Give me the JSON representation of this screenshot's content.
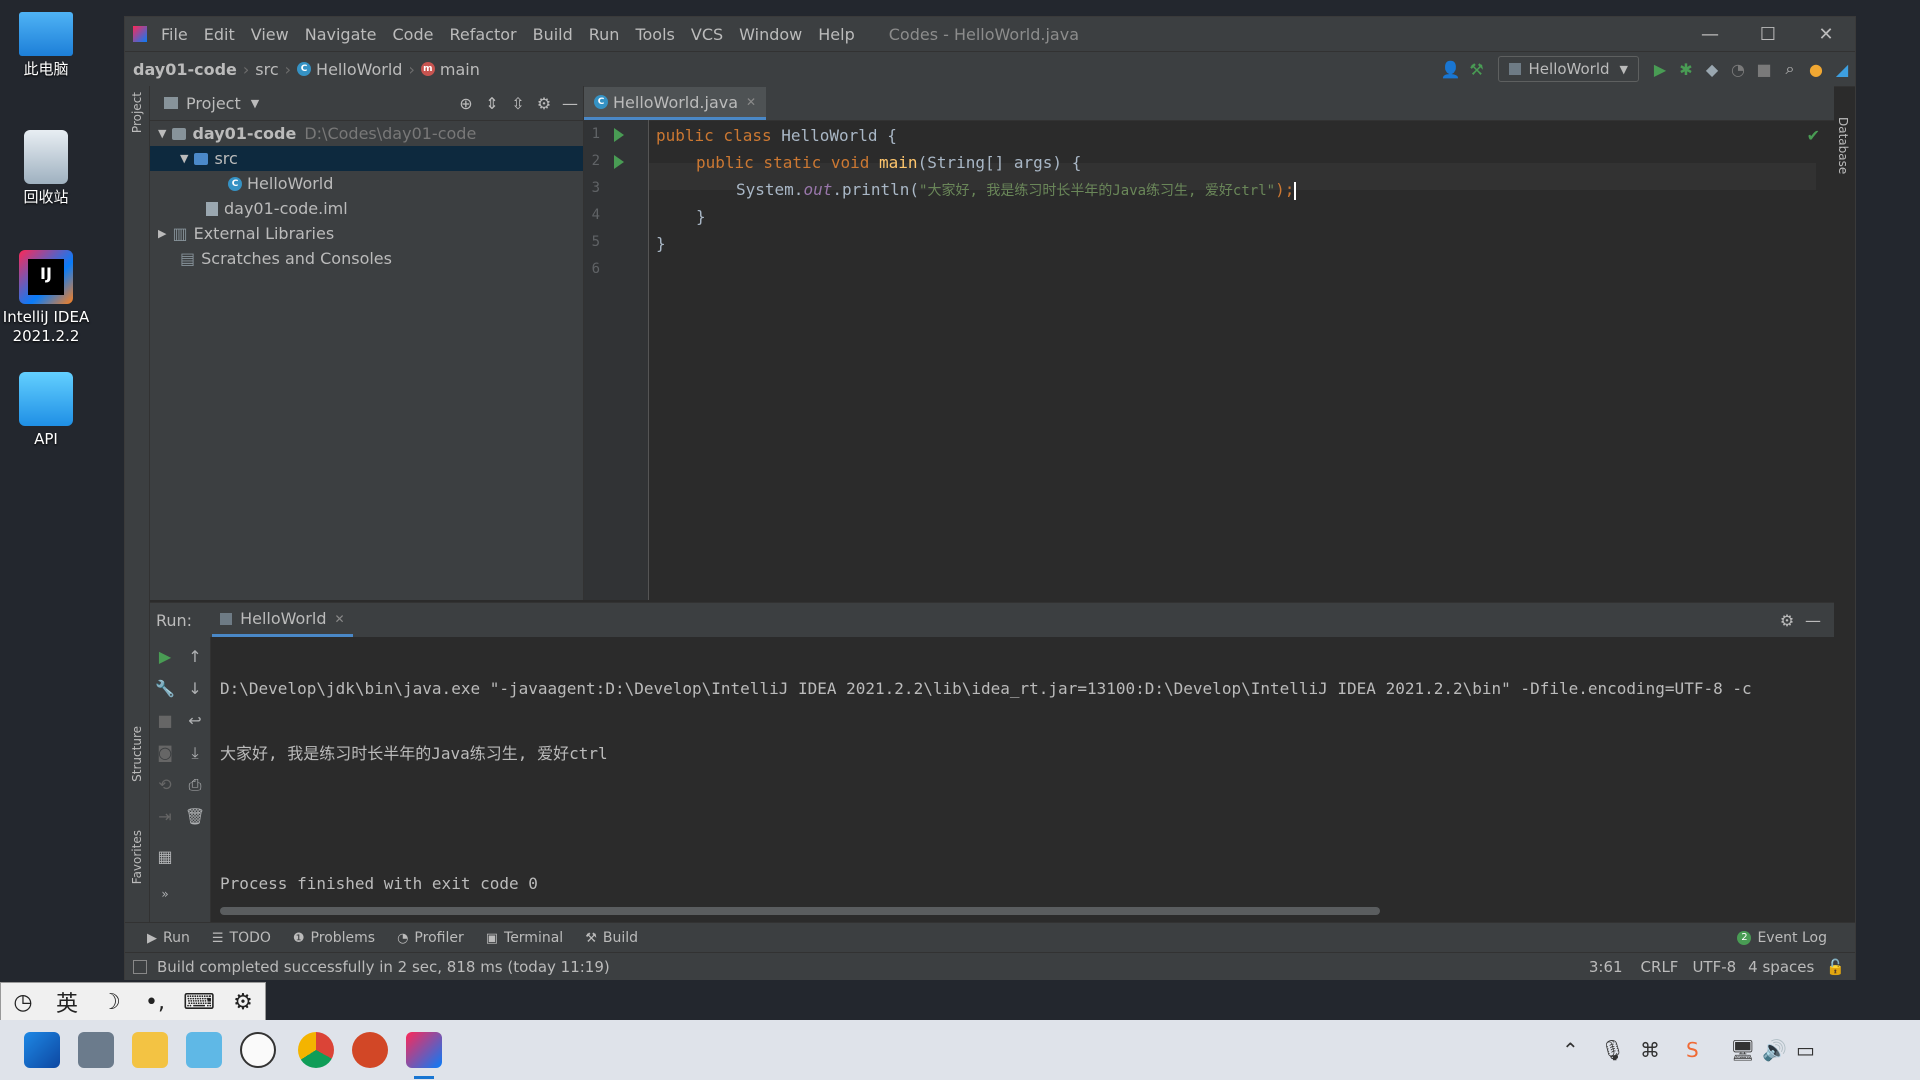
{
  "desktop": {
    "icons": [
      {
        "label": "此电脑"
      },
      {
        "label": "回收站"
      },
      {
        "label": "IntelliJ IDEA\n2021.2.2"
      },
      {
        "label": "API"
      }
    ]
  },
  "window": {
    "title": "Codes - HelloWorld.java",
    "menu": [
      "File",
      "Edit",
      "View",
      "Navigate",
      "Code",
      "Refactor",
      "Build",
      "Run",
      "Tools",
      "VCS",
      "Window",
      "Help"
    ],
    "controls": {
      "minimize": "—",
      "maximize": "☐",
      "close": "✕"
    }
  },
  "navbar": {
    "breadcrumb": [
      "day01-code",
      "src",
      "HelloWorld",
      "main"
    ],
    "run_config": "HelloWorld"
  },
  "tool_stripe": {
    "project": "Project",
    "structure": "Structure",
    "favorites": "Favorites",
    "database": "Database"
  },
  "project_panel": {
    "title": "Project",
    "tree": [
      {
        "label": "day01-code",
        "path": "D:\\Codes\\day01-code"
      },
      {
        "label": "src"
      },
      {
        "label": "HelloWorld"
      },
      {
        "label": "day01-code.iml"
      },
      {
        "label": "External Libraries"
      },
      {
        "label": "Scratches and Consoles"
      }
    ]
  },
  "editor": {
    "tab": "HelloWorld.java",
    "line_numbers": [
      "1",
      "2",
      "3",
      "4",
      "5",
      "6"
    ],
    "lines": {
      "l1_kw": "public class ",
      "l1_name": "HelloWorld {",
      "l2_kw": "public static void ",
      "l2_fn": "main",
      "l2_rest": "(String[] args) {",
      "l3_a": "System.",
      "l3_out": "out",
      "l3_b": ".println(",
      "l3_str": "\"大家好, 我是练习时长半年的Java练习生, 爱好ctrl\"",
      "l3_end": ");",
      "l4": "}",
      "l5": "}"
    }
  },
  "run_panel": {
    "label": "Run:",
    "tab": "HelloWorld",
    "console": [
      "D:\\Develop\\jdk\\bin\\java.exe \"-javaagent:D:\\Develop\\IntelliJ IDEA 2021.2.2\\lib\\idea_rt.jar=13100:D:\\Develop\\IntelliJ IDEA 2021.2.2\\bin\" -Dfile.encoding=UTF-8 -c",
      "大家好, 我是练习时长半年的Java练习生, 爱好ctrl",
      "",
      "Process finished with exit code 0"
    ]
  },
  "bottom_tabs": [
    "Run",
    "TODO",
    "Problems",
    "Profiler",
    "Terminal",
    "Build"
  ],
  "event_log": {
    "count": "2",
    "label": "Event Log"
  },
  "status": {
    "message": "Build completed successfully in 2 sec, 818 ms (today 11:19)",
    "position": "3:61",
    "line_sep": "CRLF",
    "encoding": "UTF-8",
    "indent": "4 spaces"
  },
  "ime": {
    "lang": "英"
  }
}
